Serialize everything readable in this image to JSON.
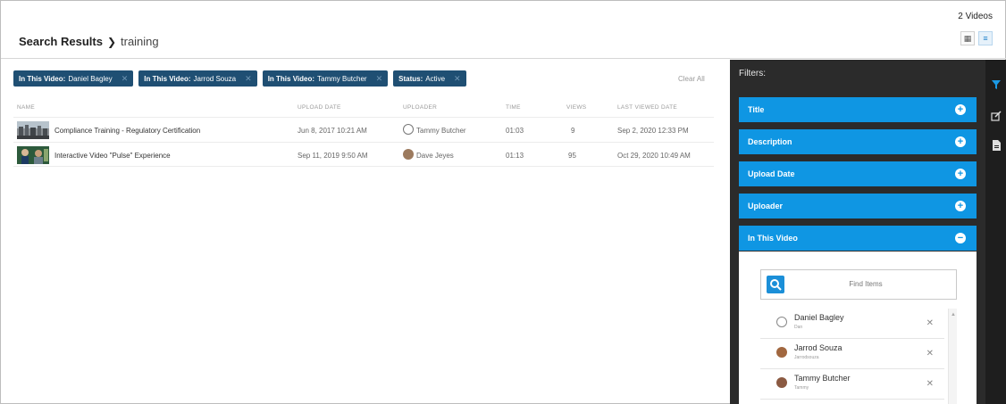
{
  "header": {
    "video_count": "2 Videos",
    "title": "Search Results",
    "search_term": "training"
  },
  "chips": [
    {
      "key": "In This Video:",
      "value": "Daniel Bagley"
    },
    {
      "key": "In This Video:",
      "value": "Jarrod Souza"
    },
    {
      "key": "In This Video:",
      "value": "Tammy Butcher"
    },
    {
      "key": "Status:",
      "value": "Active"
    }
  ],
  "clear_all": "Clear All",
  "table": {
    "columns": [
      "NAME",
      "UPLOAD DATE",
      "UPLOADER",
      "TIME",
      "VIEWS",
      "LAST VIEWED DATE"
    ],
    "rows": [
      {
        "name": "Compliance Training - Regulatory Certification",
        "upload_date": "Jun 8, 2017 10:21 AM",
        "uploader": "Tammy Butcher",
        "time": "01:03",
        "views": "9",
        "last_viewed": "Sep 2, 2020 12:33 PM"
      },
      {
        "name": "Interactive Video \"Pulse\" Experience",
        "upload_date": "Sep 11, 2019 9:50 AM",
        "uploader": "Dave Jeyes",
        "time": "01:13",
        "views": "95",
        "last_viewed": "Oct 29, 2020 10:49 AM"
      }
    ]
  },
  "filters": {
    "title": "Filters:",
    "sections": [
      {
        "label": "Title",
        "icon": "plus-circle-icon"
      },
      {
        "label": "Description",
        "icon": "plus-circle-icon"
      },
      {
        "label": "Upload Date",
        "icon": "plus-circle-icon"
      },
      {
        "label": "Uploader",
        "icon": "plus-circle-icon"
      },
      {
        "label": "In This Video",
        "icon": "minus-circle-icon"
      }
    ],
    "find_placeholder": "Find Items",
    "people": [
      {
        "name": "Daniel Bagley",
        "username": "Dan"
      },
      {
        "name": "Jarrod Souza",
        "username": "Jarrodsouza"
      },
      {
        "name": "Tammy Butcher",
        "username": "Tammy"
      }
    ]
  },
  "colors": {
    "chip": "#1f4f73",
    "filter_bar": "#0f96e3",
    "panel": "#2b2b2b",
    "rail": "#1e1e1e"
  }
}
